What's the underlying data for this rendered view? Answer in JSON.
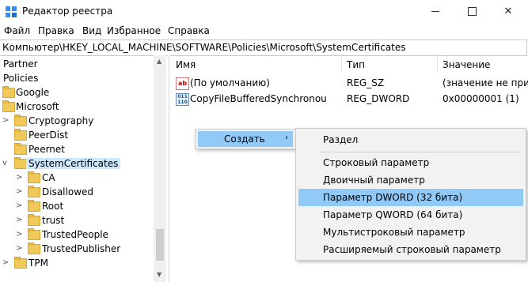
{
  "window": {
    "title": "Редактор реестра",
    "controls": {
      "minimize": "",
      "maximize": "",
      "close": "✕"
    }
  },
  "menu": [
    "Файл",
    "Правка",
    "Вид",
    "Избранное",
    "Справка"
  ],
  "address": "Компьютер\\HKEY_LOCAL_MACHINE\\SOFTWARE\\Policies\\Microsoft\\SystemCertificates",
  "tree": [
    {
      "label": "Partner"
    },
    {
      "label": "Policies"
    },
    {
      "label": "Google"
    },
    {
      "label": "Microsoft"
    },
    {
      "label": "Cryptography"
    },
    {
      "label": "PeerDist"
    },
    {
      "label": "Peernet"
    },
    {
      "label": "SystemCertificates"
    },
    {
      "label": "CA"
    },
    {
      "label": "Disallowed"
    },
    {
      "label": "Root"
    },
    {
      "label": "trust"
    },
    {
      "label": "TrustedPeople"
    },
    {
      "label": "TrustedPublisher"
    },
    {
      "label": "TPM"
    }
  ],
  "columns": {
    "name": "Имя",
    "type": "Тип",
    "value": "Значение"
  },
  "values": [
    {
      "icon": "string-value-icon",
      "icon_text": "ab",
      "name": "(По умолчанию)",
      "type": "REG_SZ",
      "data": "(значение не присв"
    },
    {
      "icon": "binary-value-icon",
      "icon_text": "011\n110",
      "name": "CopyFileBufferedSynchronousIo",
      "type": "REG_DWORD",
      "data": "0x00000001 (1)"
    }
  ],
  "context_menu": {
    "create_label": "Создать",
    "arrow": "›"
  },
  "submenu": {
    "key": "Раздел",
    "items": [
      "Строковый параметр",
      "Двоичный параметр",
      "Параметр DWORD (32 бита)",
      "Параметр QWORD (64 бита)",
      "Мультистроковый параметр",
      "Расширяемый строковый параметр"
    ],
    "highlighted": "Параметр DWORD (32 бита)"
  },
  "colors": {
    "highlight": "#91c9f7",
    "selected_tree": "#cce8ff",
    "folder": "#f0c95a"
  }
}
